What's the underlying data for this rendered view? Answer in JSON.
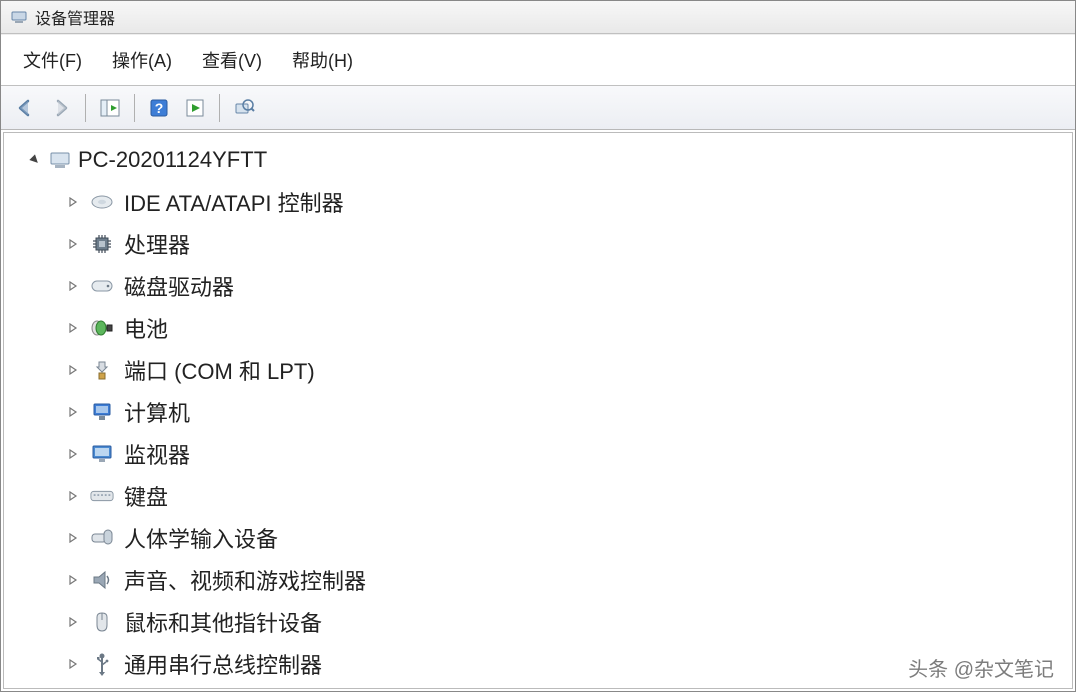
{
  "window": {
    "title": "设备管理器"
  },
  "menu": {
    "file": "文件(F)",
    "action": "操作(A)",
    "view": "查看(V)",
    "help": "帮助(H)"
  },
  "root": {
    "label": "PC-20201124YFTT"
  },
  "categories": [
    {
      "label": "IDE ATA/ATAPI 控制器",
      "icon": "disk-controller"
    },
    {
      "label": "处理器",
      "icon": "cpu"
    },
    {
      "label": "磁盘驱动器",
      "icon": "disk-drive"
    },
    {
      "label": "电池",
      "icon": "battery"
    },
    {
      "label": "端口 (COM 和 LPT)",
      "icon": "port"
    },
    {
      "label": "计算机",
      "icon": "computer"
    },
    {
      "label": "监视器",
      "icon": "monitor"
    },
    {
      "label": "键盘",
      "icon": "keyboard"
    },
    {
      "label": "人体学输入设备",
      "icon": "hid"
    },
    {
      "label": "声音、视频和游戏控制器",
      "icon": "sound"
    },
    {
      "label": "鼠标和其他指针设备",
      "icon": "mouse"
    },
    {
      "label": "通用串行总线控制器",
      "icon": "usb"
    }
  ],
  "watermark": "头条 @杂文笔记"
}
